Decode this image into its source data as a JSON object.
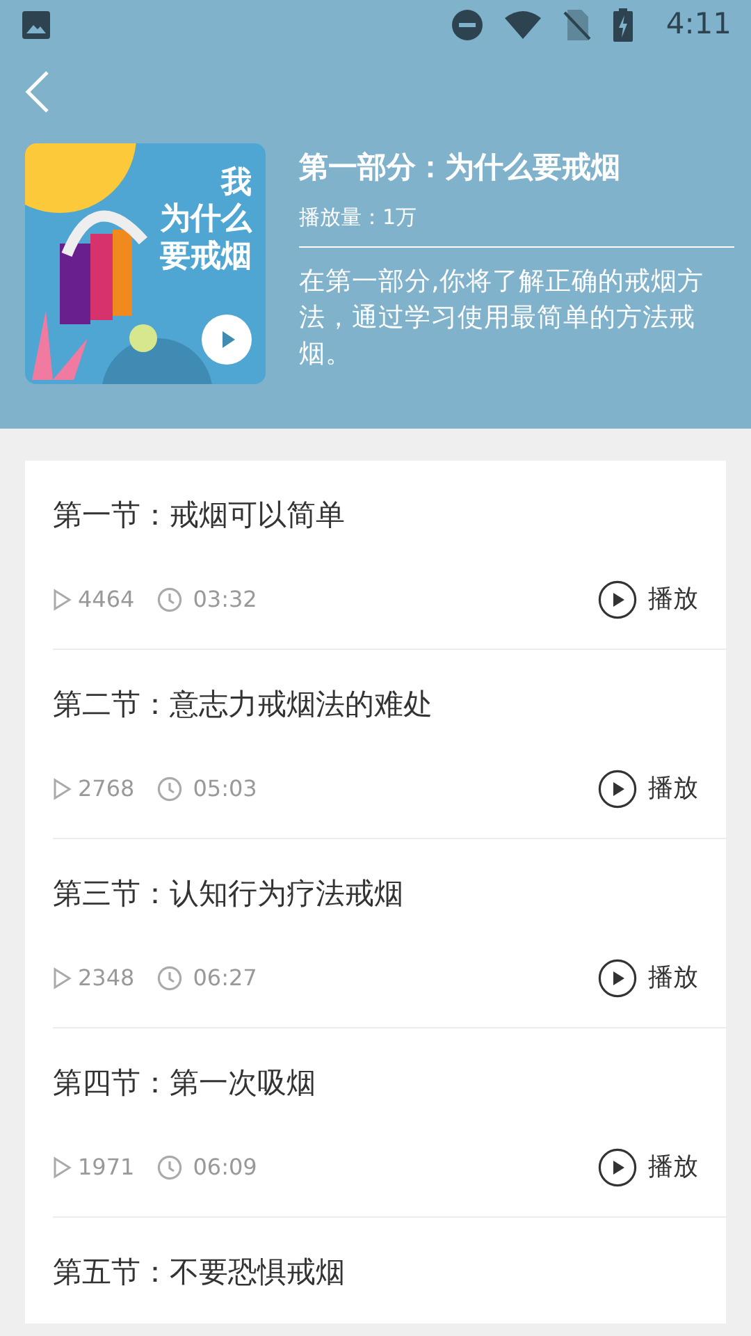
{
  "status_bar": {
    "time": "4:11"
  },
  "header": {
    "cover_text": [
      "我",
      "为什么",
      "要戒烟"
    ],
    "title": "第一部分：为什么要戒烟",
    "plays": "播放量：1万",
    "description": "在第一部分,你将了解正确的戒烟方法，通过学习使用最简单的方法戒烟。"
  },
  "lessons": [
    {
      "title": "第一节：戒烟可以简单",
      "plays": "4464",
      "duration": "03:32",
      "action": "播放"
    },
    {
      "title": "第二节：意志力戒烟法的难处",
      "plays": "2768",
      "duration": "05:03",
      "action": "播放"
    },
    {
      "title": "第三节：认知行为疗法戒烟",
      "plays": "2348",
      "duration": "06:27",
      "action": "播放"
    },
    {
      "title": "第四节：第一次吸烟",
      "plays": "1971",
      "duration": "06:09",
      "action": "播放"
    },
    {
      "title": "第五节：不要恐惧戒烟"
    }
  ]
}
